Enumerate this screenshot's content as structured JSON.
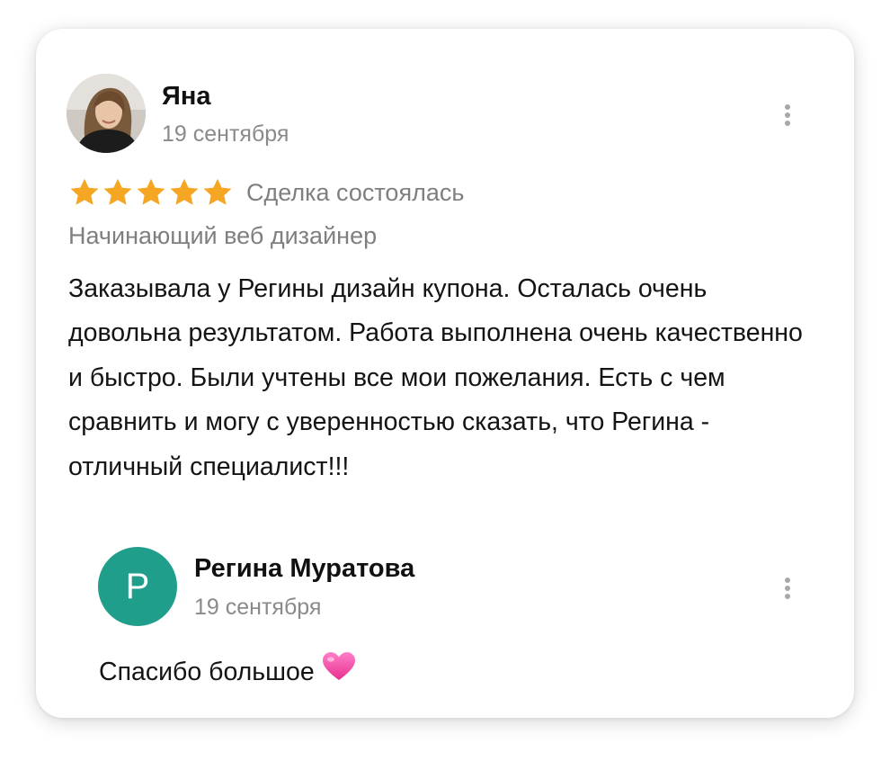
{
  "review": {
    "author_name": "Яна",
    "date": "19 сентября",
    "avatar_icon": "user-photo",
    "rating": 5,
    "rating_max": 5,
    "star_color": "#f5a623",
    "deal_status": "Сделка состоялась",
    "service": "Начинающий веб дизайнер",
    "text": "Заказывала у Регины дизайн купона. Осталась очень довольна результатом. Работа выполнена очень качественно и быстро. Были учтены все мои пожелания. Есть с чем сравнить и могу с уверенностью сказать, что Регина - отличный специалист!!!",
    "menu_icon": "more-vertical-icon"
  },
  "reply": {
    "avatar_letter": "Р",
    "avatar_color": "#1f9e8c",
    "author_name": "Регина Муратова",
    "date": "19 сентября",
    "text": "Спасибо большое",
    "emoji": "pink-heart-icon",
    "menu_icon": "more-vertical-icon"
  }
}
